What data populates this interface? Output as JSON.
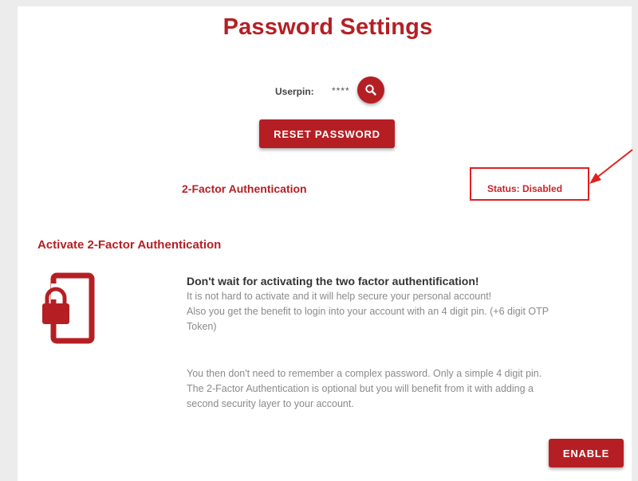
{
  "page": {
    "title": "Password Settings"
  },
  "userpin": {
    "label": "Userpin:",
    "value": "****",
    "search_icon": "search-icon"
  },
  "reset_button": {
    "label": "RESET PASSWORD"
  },
  "two_factor": {
    "title": "2-Factor Authentication",
    "status": "Status: Disabled"
  },
  "activate": {
    "title": "Activate 2-Factor Authentication",
    "icon": "phone-lock-icon",
    "heading": "Don't wait for activating the two factor authentification!",
    "lines": [
      "It is not hard to activate and it will help secure your personal account!",
      "Also you get the benefit to login into your account with an 4 digit pin. (+6 digit OTP",
      "Token)"
    ],
    "lines2": [
      "You then don't need to remember a complex password. Only a simple 4 digit pin.",
      "The 2-Factor Authentication is optional but you will benefit from it with adding a",
      "second security layer to your account."
    ],
    "enable_label": "ENABLE"
  },
  "colors": {
    "brand": "#b51f24",
    "highlight": "#e02020"
  }
}
